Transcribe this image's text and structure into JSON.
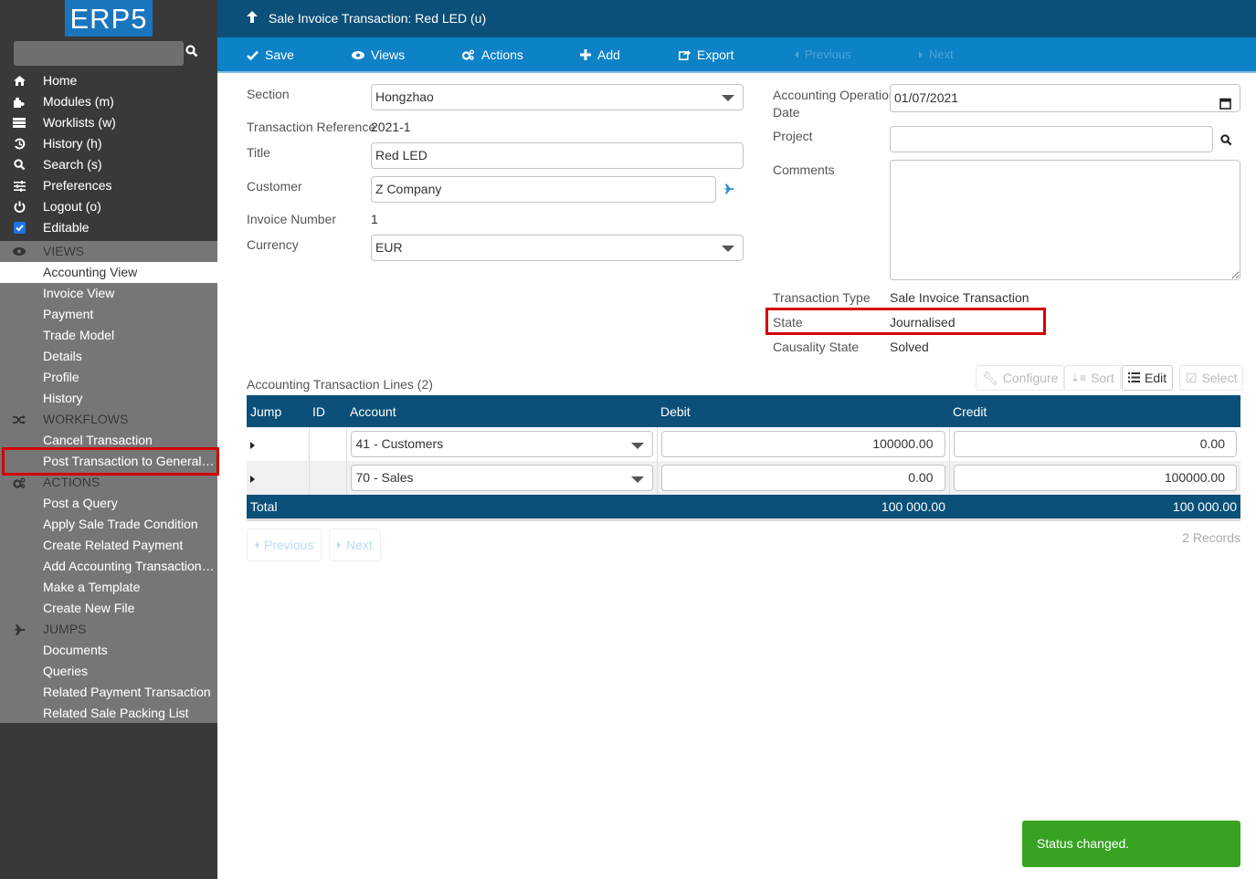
{
  "app": {
    "logo": "ERP5"
  },
  "header": {
    "title": "Sale Invoice Transaction: Red LED (u)"
  },
  "toolbar": {
    "save": "Save",
    "views": "Views",
    "actions": "Actions",
    "add": "Add",
    "export": "Export",
    "previous": "Previous",
    "next": "Next"
  },
  "sidebar": {
    "search_value": "",
    "nav": [
      {
        "label": "Home",
        "icon": "home-icon"
      },
      {
        "label": "Modules (m)",
        "icon": "puzzle-icon"
      },
      {
        "label": "Worklists (w)",
        "icon": "tasks-icon"
      },
      {
        "label": "History (h)",
        "icon": "history-icon"
      },
      {
        "label": "Search (s)",
        "icon": "search-icon"
      },
      {
        "label": "Preferences",
        "icon": "sliders-icon"
      },
      {
        "label": "Logout (o)",
        "icon": "power-icon"
      },
      {
        "label": "Editable",
        "icon": "checkbox-checked-icon"
      }
    ],
    "sections": {
      "views": {
        "title": "VIEWS",
        "items": [
          "Accounting View",
          "Invoice View",
          "Payment",
          "Trade Model",
          "Details",
          "Profile",
          "History"
        ],
        "active": "Accounting View"
      },
      "workflows": {
        "title": "WORKFLOWS",
        "items": [
          "Cancel Transaction",
          "Post Transaction to General L..."
        ]
      },
      "actions": {
        "title": "ACTIONS",
        "items": [
          "Post a Query",
          "Apply Sale Trade Condition",
          "Create Related Payment",
          "Add Accounting Transaction L...",
          "Make a Template",
          "Create New File"
        ]
      },
      "jumps": {
        "title": "JUMPS",
        "items": [
          "Documents",
          "Queries",
          "Related Payment Transaction",
          "Related Sale Packing List"
        ]
      }
    }
  },
  "form": {
    "section": {
      "label": "Section",
      "value": "Hongzhao"
    },
    "transaction_reference": {
      "label": "Transaction Reference",
      "value": "2021-1"
    },
    "title": {
      "label": "Title",
      "value": "Red LED"
    },
    "customer": {
      "label": "Customer",
      "value": "Z Company"
    },
    "invoice_number": {
      "label": "Invoice Number",
      "value": "1"
    },
    "currency": {
      "label": "Currency",
      "value": "EUR"
    },
    "operation_date": {
      "label_line1": "Accounting Operation",
      "label_line2": "Date",
      "value": "01/07/2021"
    },
    "project": {
      "label": "Project",
      "value": ""
    },
    "comments": {
      "label": "Comments",
      "value": ""
    },
    "transaction_type": {
      "label": "Transaction Type",
      "value": "Sale Invoice Transaction"
    },
    "state": {
      "label": "State",
      "value": "Journalised"
    },
    "causality_state": {
      "label": "Causality State",
      "value": "Solved"
    }
  },
  "listbox": {
    "title": "Accounting Transaction Lines (2)",
    "buttons": {
      "configure": "Configure",
      "sort": "Sort",
      "edit": "Edit",
      "select": "Select"
    },
    "columns": [
      "Jump",
      "ID",
      "Account",
      "Debit",
      "Credit"
    ],
    "rows": [
      {
        "id": "",
        "account": "41 - Customers",
        "debit": "100000.00",
        "credit": "0.00"
      },
      {
        "id": "",
        "account": "70 - Sales",
        "debit": "0.00",
        "credit": "100000.00"
      }
    ],
    "total": {
      "label": "Total",
      "debit": "100 000.00",
      "credit": "100 000.00"
    },
    "pagination": {
      "previous": "Previous",
      "next": "Next"
    },
    "records": "2 Records"
  },
  "notification": {
    "message": "Status changed."
  }
}
